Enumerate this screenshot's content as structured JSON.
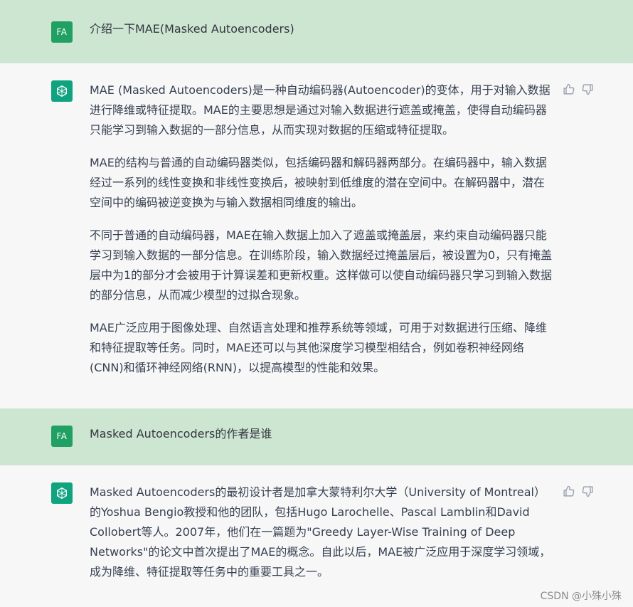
{
  "conversation": {
    "user_avatar_initials": "FA",
    "messages": [
      {
        "role": "user",
        "text": "介绍一下MAE(Masked Autoencoders)"
      },
      {
        "role": "assistant",
        "paragraphs": [
          "MAE (Masked Autoencoders)是一种自动编码器(Autoencoder)的变体，用于对输入数据进行降维或特征提取。MAE的主要思想是通过对输入数据进行遮盖或掩盖，使得自动编码器只能学习到输入数据的一部分信息，从而实现对数据的压缩或特征提取。",
          "MAE的结构与普通的自动编码器类似，包括编码器和解码器两部分。在编码器中，输入数据经过一系列的线性变换和非线性变换后，被映射到低维度的潜在空间中。在解码器中，潜在空间中的编码被逆变换为与输入数据相同维度的输出。",
          "不同于普通的自动编码器，MAE在输入数据上加入了遮盖或掩盖层，来约束自动编码器只能学习到输入数据的一部分信息。在训练阶段，输入数据经过掩盖层后，被设置为0，只有掩盖层中为1的部分才会被用于计算误差和更新权重。这样做可以使自动编码器只学习到输入数据的部分信息，从而减少模型的过拟合现象。",
          "MAE广泛应用于图像处理、自然语言处理和推荐系统等领域，可用于对数据进行压缩、降维和特征提取等任务。同时，MAE还可以与其他深度学习模型相结合，例如卷积神经网络(CNN)和循环神经网络(RNN)，以提高模型的性能和效果。"
        ]
      },
      {
        "role": "user",
        "text": "Masked Autoencoders的作者是谁"
      },
      {
        "role": "assistant",
        "paragraphs": [
          "Masked Autoencoders的最初设计者是加拿大蒙特利尔大学（University of Montreal）的Yoshua Bengio教授和他的团队，包括Hugo Larochelle、Pascal Lamblin和David Collobert等人。2007年，他们在一篇题为\"Greedy Layer-Wise Training of Deep Networks\"的论文中首次提出了MAE的概念。自此以后，MAE被广泛应用于深度学习领域，成为降维、特征提取等任务中的重要工具之一。"
        ]
      }
    ]
  },
  "icons": {
    "bot_avatar": "openai-logo-icon",
    "like": "thumbs-up-icon",
    "dislike": "thumbs-down-icon"
  },
  "colors": {
    "user_bg": "#cde6d1",
    "assistant_bg": "#f7f7f8",
    "user_avatar": "#21a063",
    "bot_avatar": "#10a37f"
  },
  "watermark": "CSDN @小殊小殊"
}
